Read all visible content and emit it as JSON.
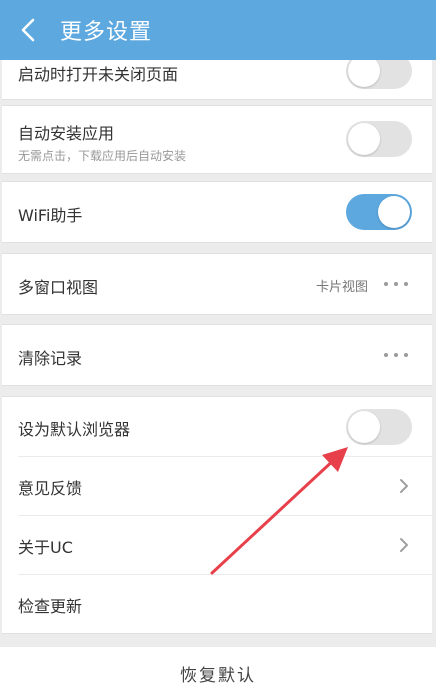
{
  "header": {
    "title": "更多设置"
  },
  "settings": {
    "open_unclosed_pages": {
      "label": "启动时打开未关闭页面",
      "enabled": false
    },
    "auto_install": {
      "label": "自动安装应用",
      "subtitle": "无需点击，下载应用后自动安装",
      "enabled": false
    },
    "wifi_assistant": {
      "label": "WiFi助手",
      "enabled": true
    },
    "multi_window": {
      "label": "多窗口视图",
      "value": "卡片视图"
    },
    "clear_history": {
      "label": "清除记录"
    },
    "default_browser": {
      "label": "设为默认浏览器",
      "enabled": false
    },
    "feedback": {
      "label": "意见反馈"
    },
    "about": {
      "label": "关于UC"
    },
    "check_update": {
      "label": "检查更新"
    }
  },
  "footer": {
    "restore_label": "恢复默认"
  },
  "colors": {
    "accent": "#5ca8df",
    "annotation_arrow": "#e8404a"
  }
}
